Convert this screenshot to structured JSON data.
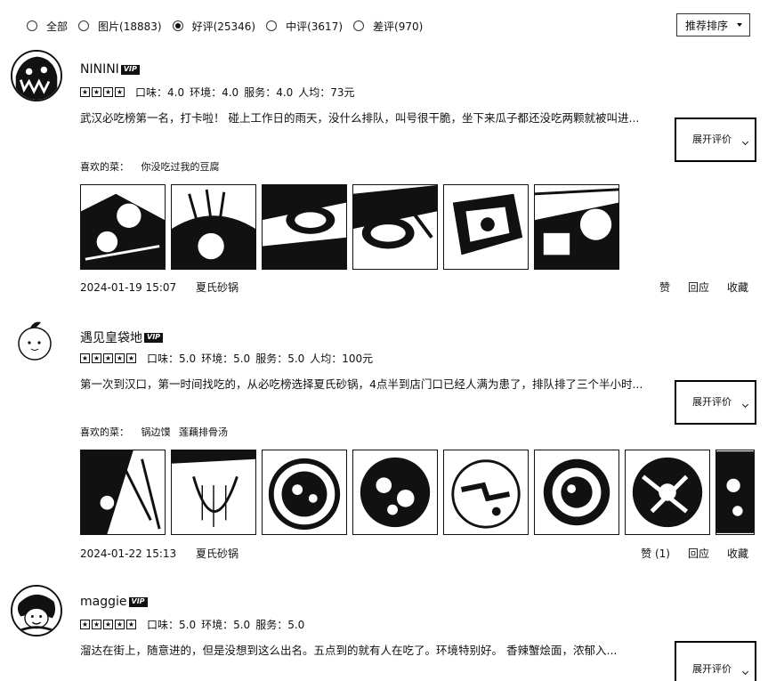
{
  "filters": [
    {
      "label": "全部",
      "checked": false
    },
    {
      "label": "图片(18883)",
      "checked": false
    },
    {
      "label": "好评(25346)",
      "checked": true
    },
    {
      "label": "中评(3617)",
      "checked": false
    },
    {
      "label": "差评(970)",
      "checked": false
    }
  ],
  "sort": {
    "label": "推荐排序"
  },
  "vip_label": "VIP",
  "expand_label": "展开评价",
  "liked_label": "喜欢的菜：",
  "reviews": [
    {
      "user": "NININI",
      "stars": 4,
      "scores": [
        "口味：4.0",
        "环境：4.0",
        "服务：4.0",
        "人均：73元"
      ],
      "text": "武汉必吃榜第一名，打卡啦！ 碰上工作日的雨天，没什么排队，叫号很干脆，坐下来瓜子都还没吃两颗就被叫进...",
      "dishes": [
        "你没吃过我的豆腐"
      ],
      "date": "2024-01-19 15:07",
      "shop": "夏氏砂锅",
      "actions": [
        "赞",
        "回应",
        "收藏"
      ]
    },
    {
      "user": "遇见皇袋地",
      "stars": 5,
      "scores": [
        "口味：5.0",
        "环境：5.0",
        "服务：5.0",
        "人均：100元"
      ],
      "text": "第一次到汉口，第一时间找吃的，从必吃榜选择夏氏砂锅，4点半到店门口已经人满为患了，排队排了三个半小时...",
      "dishes": [
        "锅边馍",
        "莲藕排骨汤"
      ],
      "date": "2024-01-22 15:13",
      "shop": "夏氏砂锅",
      "actions": [
        "赞 (1)",
        "回应",
        "收藏"
      ]
    },
    {
      "user": "maggie",
      "stars": 5,
      "scores": [
        "口味：5.0",
        "环境：5.0",
        "服务：5.0"
      ],
      "text": "溜达在街上，随意进的，但是没想到这么出名。五点到的就有人在吃了。环境特别好。 香辣蟹烩面，浓郁入..."
    }
  ]
}
